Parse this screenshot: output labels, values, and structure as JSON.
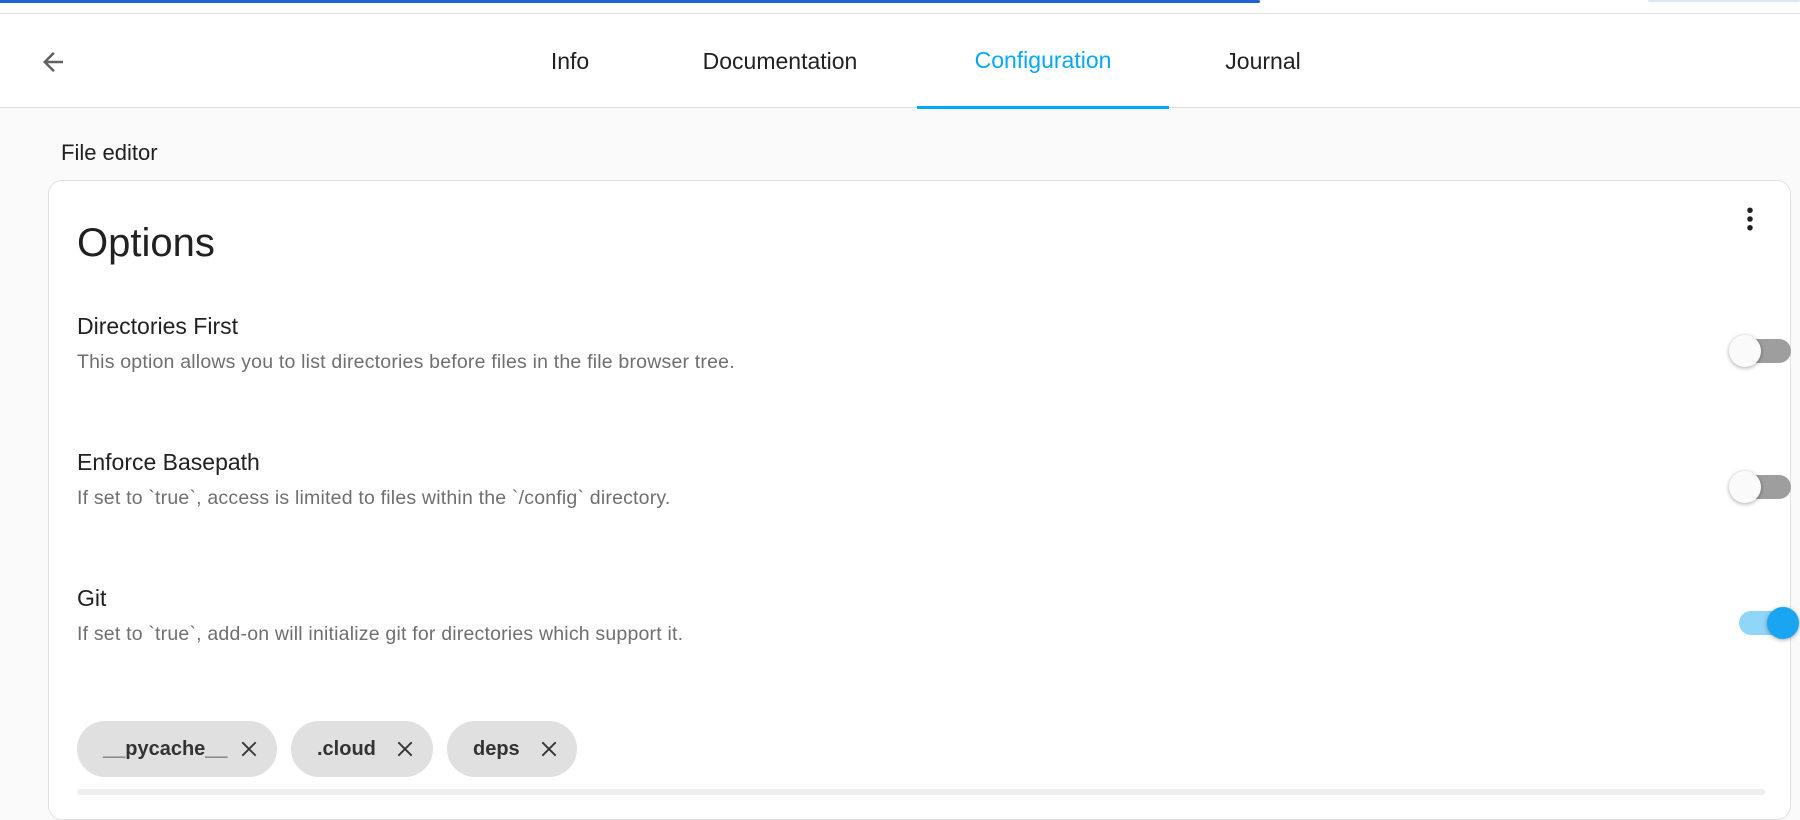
{
  "progress": {
    "fraction": 0.7
  },
  "header": {
    "tabs": [
      {
        "label": "Info"
      },
      {
        "label": "Documentation"
      },
      {
        "label": "Configuration"
      },
      {
        "label": "Journal"
      }
    ],
    "active_tab": "Configuration"
  },
  "section_title": "File editor",
  "card": {
    "title": "Options",
    "options": [
      {
        "name": "Directories First",
        "description": "This option allows you to list directories before files in the file browser tree.",
        "enabled": false
      },
      {
        "name": "Enforce Basepath",
        "description": "If set to `true`, access is limited to files within the `/config` directory.",
        "enabled": false
      },
      {
        "name": "Git",
        "description": "If set to `true`, add-on will initialize git for directories which support it.",
        "enabled": true
      }
    ],
    "chips": [
      {
        "label": "__pycache__"
      },
      {
        "label": ".cloud"
      },
      {
        "label": "deps"
      }
    ]
  },
  "colors": {
    "accent": "#03a9f4",
    "progress": "#1e62d6",
    "toggle_on": "#1aa5f3",
    "toggle_off_track": "#9e9e9e"
  },
  "icons": [
    "arrow-left-icon",
    "more-vertical-icon",
    "close-icon"
  ]
}
